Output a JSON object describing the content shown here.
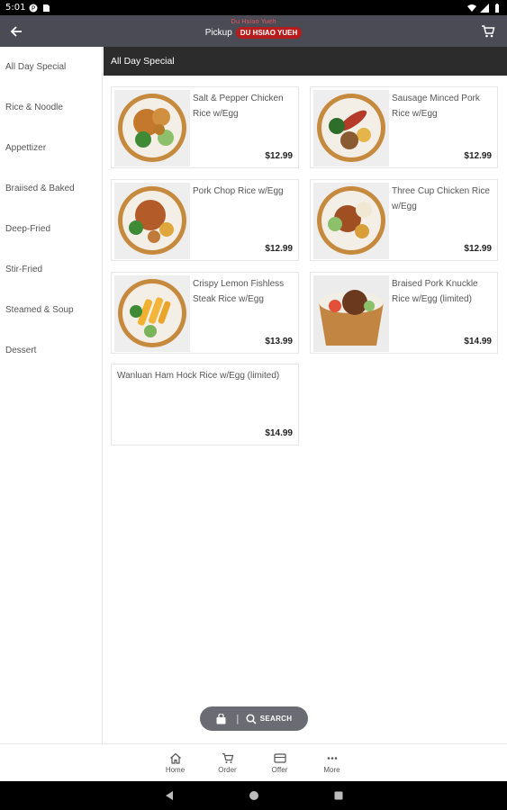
{
  "status_bar": {
    "time": "5:01"
  },
  "header": {
    "store_name_small": "Du Hsiao Yueh",
    "mode": "Pickup",
    "store_badge": "DU HSIAO YUEH"
  },
  "sidebar": {
    "items": [
      {
        "label": "All Day Special"
      },
      {
        "label": "Rice & Noodle"
      },
      {
        "label": "Appettizer"
      },
      {
        "label": "Braiised & Baked"
      },
      {
        "label": "Deep-Fried"
      },
      {
        "label": "Stir-Fried"
      },
      {
        "label": "Steamed & Soup"
      },
      {
        "label": "Dessert"
      }
    ]
  },
  "section": {
    "title": "All Day Special"
  },
  "items": [
    {
      "name": "Salt & Pepper Chicken Rice w/Egg",
      "price": "$12.99"
    },
    {
      "name": "Sausage Minced Pork Rice w/Egg",
      "price": "$12.99"
    },
    {
      "name": "Pork Chop Rice w/Egg",
      "price": "$12.99"
    },
    {
      "name": "Three Cup Chicken Rice w/Egg",
      "price": "$12.99"
    },
    {
      "name": "Crispy Lemon Fishless Steak Rice w/Egg",
      "price": "$13.99"
    },
    {
      "name": "Braised Pork Knuckle Rice w/Egg (limited)",
      "price": "$14.99"
    },
    {
      "name": "Wanluan Ham Hock Rice w/Egg (limited)",
      "price": "$14.99"
    }
  ],
  "search_pill": {
    "separator": "|",
    "label": "SEARCH"
  },
  "bottom_nav": {
    "home": "Home",
    "order": "Order",
    "offer": "Offer",
    "more": "More"
  },
  "icons": {
    "back": "arrow-left-icon",
    "cart": "cart-icon",
    "bag": "shopping-bag-icon",
    "search": "magnifier-icon",
    "home": "home-icon",
    "order": "order-cart-icon",
    "offer": "ticket-icon",
    "more": "dots-icon"
  },
  "colors": {
    "app_bar": "#4b4b55",
    "badge": "#b71c1c",
    "section_header": "#2c2c2c",
    "pill": "#6b6b73"
  }
}
